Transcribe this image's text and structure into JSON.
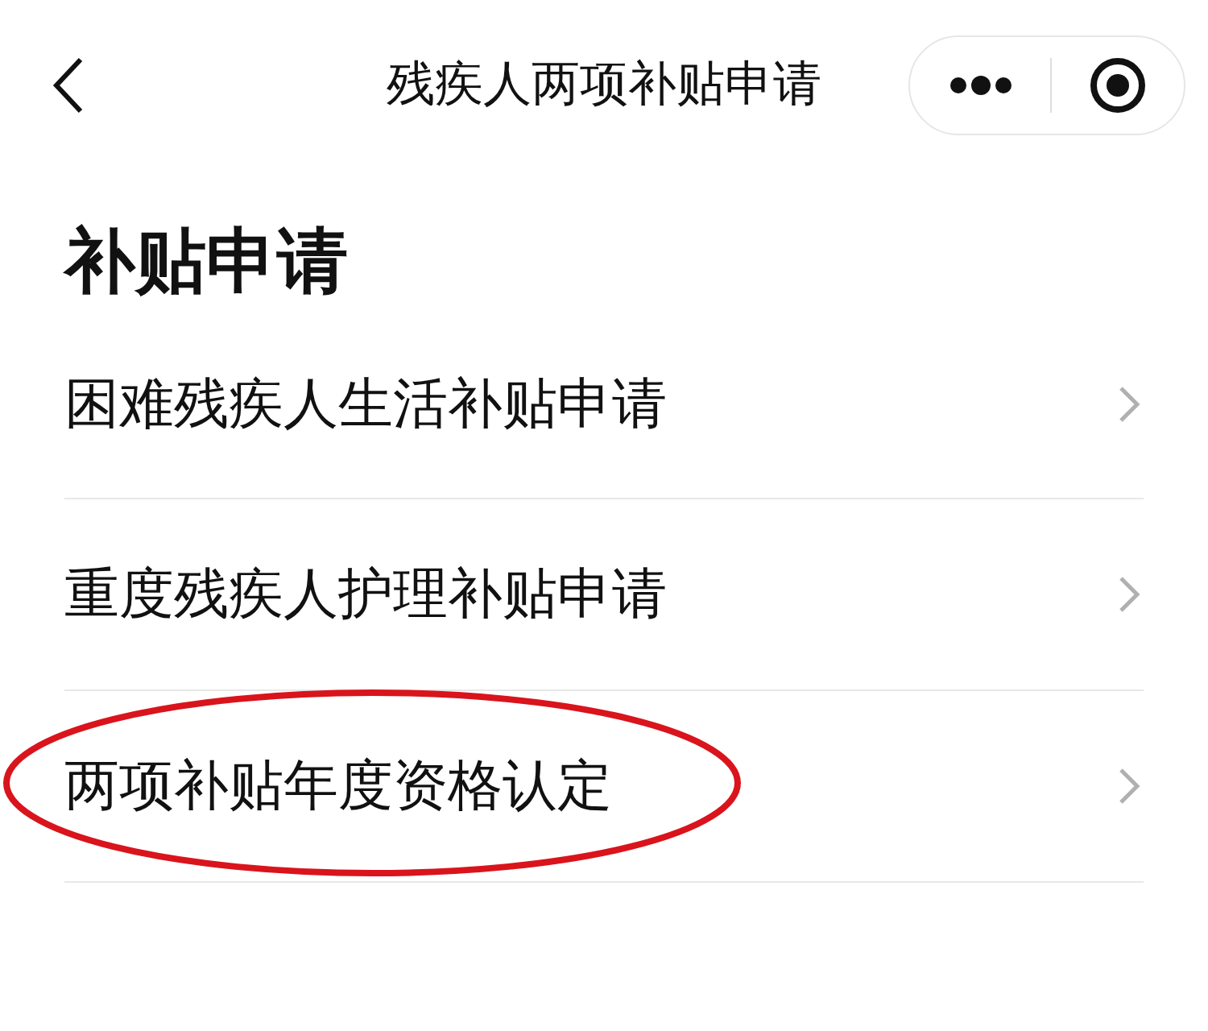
{
  "nav_bar": {
    "title": "残疾人两项补贴申请"
  },
  "section": {
    "heading": "补贴申请"
  },
  "items": [
    {
      "label": "困难残疾人生活补贴申请",
      "highlighted": false
    },
    {
      "label": "重度残疾人护理补贴申请",
      "highlighted": false
    },
    {
      "label": "两项补贴年度资格认定",
      "highlighted": true
    }
  ]
}
